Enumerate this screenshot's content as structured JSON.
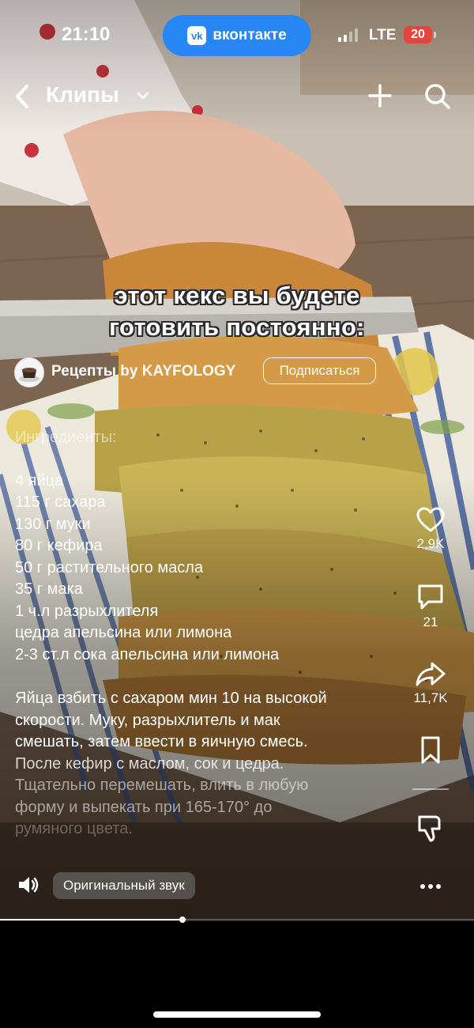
{
  "status_bar": {
    "time": "21:10",
    "app_pill": "вконтакте",
    "app_logo": "vk",
    "network": "LTE",
    "battery": "20",
    "battery_color": "#e5443f"
  },
  "header": {
    "title": "Клипы"
  },
  "video": {
    "caption_line1": "этот кекс вы будете",
    "caption_line2": "готовить постоянно:",
    "progress": 0.385
  },
  "author": {
    "name": "Рецепты by KAYFOLOGY",
    "subscribe_label": "Подписаться"
  },
  "description": {
    "heading": "Ингредиенты:",
    "ingredients": [
      "4 яйца",
      "115 г сахара",
      "130 г муки",
      "80 г кефира",
      "50 г растительного масла",
      "35 г мака",
      "1 ч.л разрыхлителя",
      "цедра апельсина или лимона",
      "2-3 ст.л сока апельсина или лимона"
    ],
    "steps": [
      "Яйца взбить с сахаром мин 10 на высокой",
      "скорости. Муку, разрыхлитель и мак",
      "смешать, затем ввести в яичную смесь.",
      "После кефир с маслом, сок и цедра.",
      "Тщательно перемешать, влить в любую",
      "форму и выпекать при 165-170° до",
      "румяного цвета."
    ]
  },
  "actions": {
    "likes": "2,9K",
    "comments": "21",
    "shares": "11,7K"
  },
  "sound": {
    "label": "Оригинальный звук"
  },
  "colors": {
    "accent": "#2787f5"
  }
}
